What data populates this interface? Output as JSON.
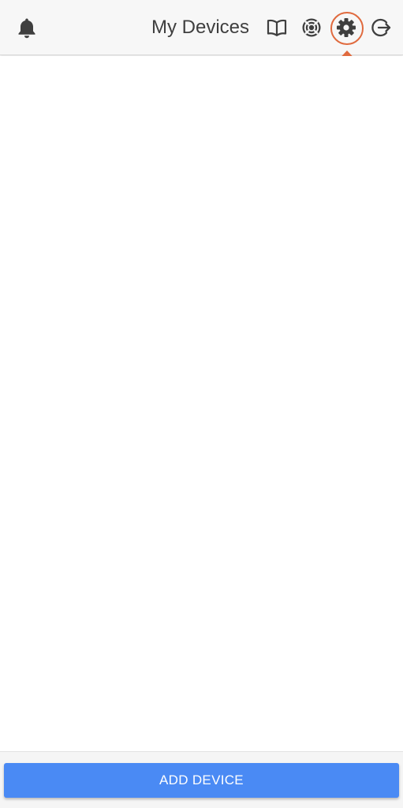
{
  "header": {
    "title": "My Devices",
    "icons": {
      "left": "bell-icon",
      "right": [
        "book-icon",
        "help-icon",
        "settings-icon",
        "logout-icon"
      ]
    }
  },
  "annotation": {
    "highlighted": "settings-icon",
    "color": "#e06a3e"
  },
  "footer": {
    "add_device_label": "ADD DEVICE"
  },
  "colors": {
    "accent": "#4a8af4",
    "icon": "#3f3f3f",
    "header_bg": "#f7f7f7"
  }
}
